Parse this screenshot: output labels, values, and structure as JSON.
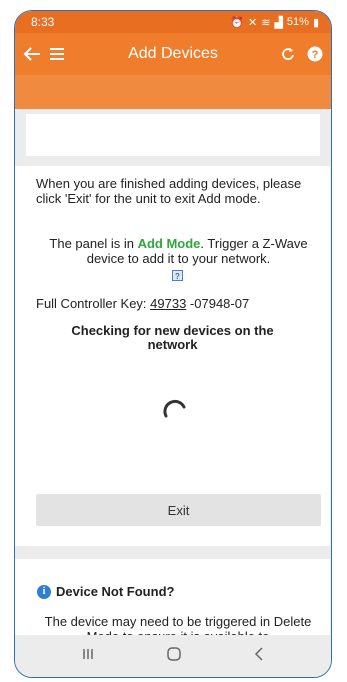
{
  "status_bar": {
    "time": "8:33",
    "icons": [
      "alarm-icon",
      "mute-icon",
      "wifi-icon",
      "signal-icon"
    ],
    "battery": "51%"
  },
  "app_bar": {
    "title": "Add Devices",
    "back_icon": "arrow-left-icon",
    "menu_icon": "hamburger-icon",
    "refresh_icon": "refresh-icon",
    "help_icon": "help-icon"
  },
  "add_mode": {
    "intro": "When you are finished adding devices, please click 'Exit' for the unit to exit Add mode.",
    "panel_prefix": "The panel is in ",
    "mode_label": "Add Mode",
    "panel_suffix": ". Trigger a Z-Wave device to add it to your network.",
    "key_label": "Full Controller Key: ",
    "key_part1": "49733",
    "key_part2": " -07948-07",
    "checking": "Checking for new devices on the network",
    "exit_label": "Exit"
  },
  "not_found": {
    "heading": "Device Not Found?",
    "body": "The device may need to be triggered in Delete Mode to ensure it is available to"
  },
  "colors": {
    "accent": "#f07d2c",
    "status_bar": "#e86f22",
    "add_mode_green": "#2da63a",
    "info_blue": "#2f7fd0"
  }
}
